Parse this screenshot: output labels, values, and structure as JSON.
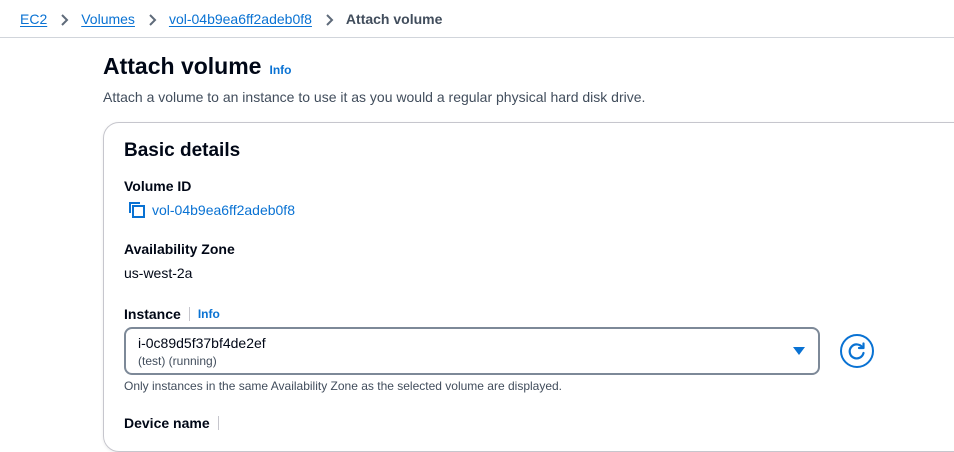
{
  "breadcrumb": {
    "items": [
      "EC2",
      "Volumes",
      "vol-04b9ea6ff2adeb0f8"
    ],
    "current": "Attach volume"
  },
  "header": {
    "title": "Attach volume",
    "info": "Info",
    "description": "Attach a volume to an instance to use it as you would a regular physical hard disk drive."
  },
  "basic_details": {
    "title": "Basic details",
    "volume_id_label": "Volume ID",
    "volume_id": "vol-04b9ea6ff2adeb0f8",
    "az_label": "Availability Zone",
    "az_value": "us-west-2a",
    "instance_label": "Instance",
    "instance_info": "Info",
    "instance_value": "i-0c89d5f37bf4de2ef",
    "instance_sub": "(test) (running)",
    "instance_hint": "Only instances in the same Availability Zone as the selected volume are displayed.",
    "next_label": "Device name"
  },
  "icons": {
    "breadcrumb_separator": "chevron-right-icon",
    "copy": "copy-icon",
    "caret": "caret-down-icon",
    "refresh": "refresh-icon"
  },
  "colors": {
    "link": "#0972d3",
    "text": "#000716",
    "border": "#7d8998"
  }
}
